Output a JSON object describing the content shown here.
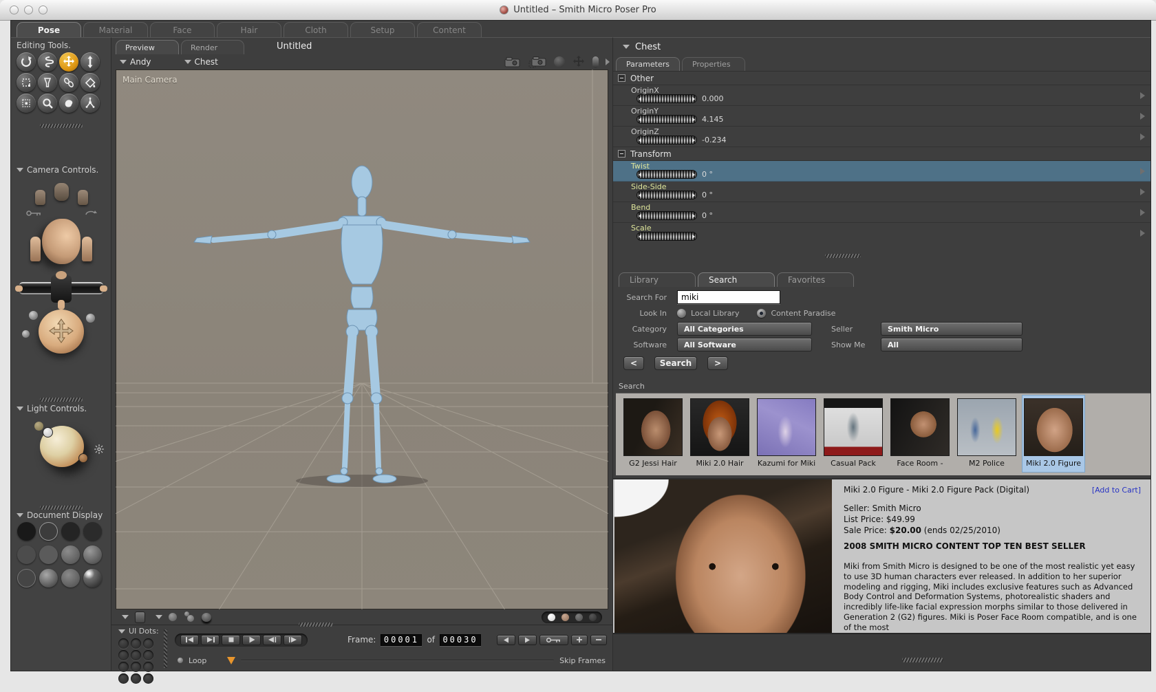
{
  "window": {
    "title": "Untitled – Smith Micro Poser Pro"
  },
  "main_tabs": [
    {
      "label": "Pose"
    },
    {
      "label": "Material"
    },
    {
      "label": "Face"
    },
    {
      "label": "Hair"
    },
    {
      "label": "Cloth"
    },
    {
      "label": "Setup"
    },
    {
      "label": "Content"
    }
  ],
  "left_panel": {
    "editing_tools_title": "Editing Tools.",
    "editing_tools": [
      "rotate",
      "twist",
      "translate-pan",
      "translate-in-out",
      "scale",
      "taper",
      "chain-break",
      "color",
      "morphing-tool",
      "zoom",
      "grouping",
      "direct-manipulation"
    ],
    "camera_controls_title": "Camera Controls.",
    "light_controls_title": "Light Controls.",
    "document_display_title": "Document Display",
    "display_modes": [
      "silhouette",
      "outline",
      "wireframe",
      "hidden-line",
      "lit-wireframe",
      "flat-shaded",
      "flat-lined",
      "cartoon",
      "smooth-shaded",
      "smooth-lined",
      "texture-shaded",
      "cartoon-with-line"
    ]
  },
  "document": {
    "preview_tab": "Preview",
    "render_tab": "Render",
    "title": "Untitled",
    "figure_selector": "Andy",
    "actor_selector": "Chest",
    "camera_label": "Main Camera"
  },
  "parameters_panel": {
    "title": "Chest",
    "tabs": [
      {
        "label": "Parameters"
      },
      {
        "label": "Properties"
      }
    ],
    "groups": [
      {
        "name": "Other",
        "params": [
          {
            "label": "OriginX",
            "value": "0.000"
          },
          {
            "label": "OriginY",
            "value": "4.145"
          },
          {
            "label": "OriginZ",
            "value": "-0.234"
          }
        ]
      },
      {
        "name": "Transform",
        "params": [
          {
            "label": "Twist",
            "value": "0 °"
          },
          {
            "label": "Side-Side",
            "value": "0 °"
          },
          {
            "label": "Bend",
            "value": "0 °"
          },
          {
            "label": "Scale",
            "value": ""
          }
        ]
      }
    ]
  },
  "library_panel": {
    "tabs": [
      {
        "label": "Library"
      },
      {
        "label": "Search"
      },
      {
        "label": "Favorites"
      }
    ],
    "search_for_label": "Search For",
    "search_value": "miki",
    "look_in_label": "Look In",
    "look_in_options": [
      {
        "label": "Local Library",
        "selected": false
      },
      {
        "label": "Content Paradise",
        "selected": true
      }
    ],
    "category_label": "Category",
    "category_value": "All Categories",
    "seller_label": "Seller",
    "seller_value": "Smith Micro",
    "software_label": "Software",
    "software_value": "All Software",
    "show_me_label": "Show Me",
    "show_me_value": "All",
    "prev_button": "<",
    "search_button": "Search",
    "next_button": ">",
    "results_label": "Search",
    "results": [
      {
        "caption": "G2 Jessi Hair"
      },
      {
        "caption": "Miki 2.0 Hair"
      },
      {
        "caption": "Kazumi for Miki"
      },
      {
        "caption": "Casual Pack"
      },
      {
        "caption": "Face Room -"
      },
      {
        "caption": "M2 Police"
      },
      {
        "caption": "Miki 2.0 Figure",
        "selected": true
      }
    ]
  },
  "product_detail": {
    "title": "Miki 2.0 Figure - Miki 2.0 Figure Pack (Digital)",
    "add_to_cart": "[Add to Cart]",
    "seller": "Seller: Smith Micro",
    "list_price": "List Price: $49.99",
    "sale_price_prefix": "Sale Price: ",
    "sale_price_value": "$20.00",
    "sale_price_suffix": " (ends 02/25/2010)",
    "banner": "2008 SMITH MICRO CONTENT TOP TEN BEST SELLER",
    "description": "Miki from Smith Micro is designed to be one of the most realistic yet easy to use 3D human characters ever released. In addition to her superior modeling and rigging, Miki includes exclusive features such as Advanced Body Control and Deformation Systems, photorealistic shaders and incredibly life-like facial expression morphs similar to those delivered in Generation 2 (G2) figures. Miki is Poser Face Room compatible, and is one of the most"
  },
  "animation": {
    "ui_dots_label": "UI Dots:",
    "frame_label": "Frame:",
    "frame_current": "00001",
    "of_label": "of",
    "frame_total": "00030",
    "loop_label": "Loop",
    "skip_frames_label": "Skip Frames"
  }
}
